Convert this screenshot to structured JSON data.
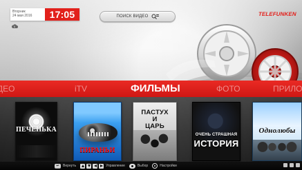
{
  "header": {
    "date_weekday": "Вторник",
    "date_full": "24 мая 2016",
    "time": "17:05",
    "search_label": "ПОИСК ВИДЕО",
    "brand": "TELEFUNKEN"
  },
  "categories": [
    {
      "label": "ДЕО"
    },
    {
      "label": "iTV"
    },
    {
      "label": "ФИЛЬМЫ"
    },
    {
      "label": "ФОТО"
    },
    {
      "label": "ПРИЛО"
    }
  ],
  "posters": [
    {
      "title": "ПЕЧЕНЬКА"
    },
    {
      "title": "ПИРАНЬИ"
    },
    {
      "title_line1": "ПАСТУХ",
      "title_line2": "И",
      "title_line3": "ЦАРЬ"
    },
    {
      "title_line1": "ОЧЕНЬ СТРАШНАЯ",
      "title_line2": "ИСТОРИЯ"
    },
    {
      "title": "Однолюбы"
    }
  ],
  "footer": {
    "key_back": "Вернуть",
    "label_control": "Управление",
    "label_select": "Выбор",
    "label_settings": "Настройки"
  },
  "colors": {
    "accent_red": "#e2211c"
  },
  "icons": {
    "cloud": "cloud-icon",
    "search": "search-icon",
    "gear": "gear-icon"
  }
}
